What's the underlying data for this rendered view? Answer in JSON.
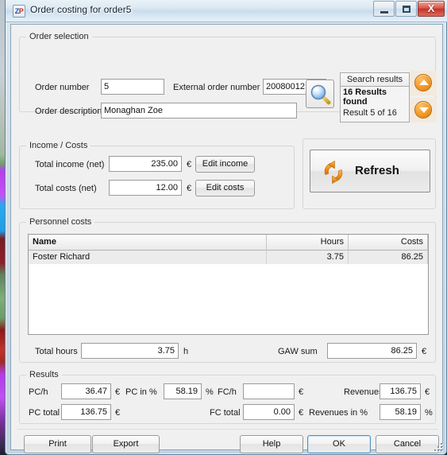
{
  "window": {
    "title": "Order costing for order5",
    "icon": "zp-app-icon",
    "icon_text_1": "Z",
    "icon_text_2": "P",
    "minimize_label": "",
    "maximize_label": "",
    "close_label": "X"
  },
  "order_selection": {
    "legend": "Order selection",
    "order_number_label": "Order number",
    "order_number_value": "5",
    "external_order_number_label": "External order number",
    "external_order_number_value": "20080012",
    "order_description_label": "Order description",
    "order_description_value": "Monaghan Zoe",
    "search_icon": "magnifier-icon",
    "search_results_header": "Search results",
    "results_found": "16 Results found",
    "result_position": "Result 5 of 16",
    "nav_up_icon": "circle-up-arrow-icon",
    "nav_down_icon": "circle-down-arrow-icon"
  },
  "income_costs": {
    "legend": "Income / Costs",
    "total_income_label": "Total income (net)",
    "total_income_value": "235.00",
    "total_income_unit": "€",
    "edit_income_label": "Edit income",
    "total_costs_label": "Total costs (net)",
    "total_costs_value": "12.00",
    "total_costs_unit": "€",
    "edit_costs_label": "Edit costs"
  },
  "refresh": {
    "label": "Refresh",
    "icon": "refresh-arrows-icon"
  },
  "personnel_costs": {
    "legend": "Personnel costs",
    "columns": [
      "Name",
      "Hours",
      "Costs"
    ],
    "sorted_column": "Name",
    "rows": [
      {
        "name": "Foster Richard",
        "hours": "3.75",
        "costs": "86.25"
      }
    ],
    "total_hours_label": "Total hours",
    "total_hours_value": "3.75",
    "total_hours_unit": "h",
    "gaw_sum_label": "GAW sum",
    "gaw_sum_value": "86.25",
    "gaw_sum_unit": "€"
  },
  "results": {
    "legend": "Results",
    "pc_h_label": "PC/h",
    "pc_h_value": "36.47",
    "pc_h_unit": "€",
    "pc_pct_label": "PC in %",
    "pc_pct_value": "58.19",
    "pc_pct_unit": "%",
    "fc_h_label": "FC/h",
    "fc_h_value": "",
    "fc_h_unit": "€",
    "revenues_label": "Revenues",
    "revenues_value": "136.75",
    "revenues_unit": "€",
    "pc_total_label": "PC total",
    "pc_total_value": "136.75",
    "pc_total_unit": "€",
    "fc_total_label": "FC total",
    "fc_total_value": "0.00",
    "fc_total_unit": "€",
    "revenues_pct_label": "Revenues in %",
    "revenues_pct_value": "58.19",
    "revenues_pct_unit": "%"
  },
  "footer": {
    "print_label": "Print",
    "export_label": "Export",
    "help_label": "Help",
    "ok_label": "OK",
    "cancel_label": "Cancel"
  },
  "colors": {
    "accent_orange": "#f29a26",
    "close_red": "#c2342a",
    "focus_blue": "#4f8fc0",
    "window_bg": "#f0f0f0"
  }
}
